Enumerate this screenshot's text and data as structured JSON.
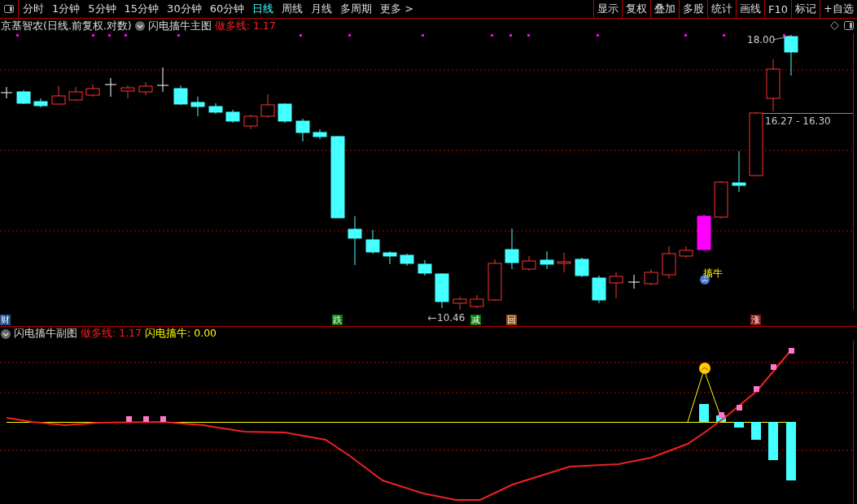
{
  "toolbar": {
    "periods": [
      {
        "label": "分时",
        "selected": false
      },
      {
        "label": "1分钟",
        "selected": false
      },
      {
        "label": "5分钟",
        "selected": false
      },
      {
        "label": "15分钟",
        "selected": false
      },
      {
        "label": "30分钟",
        "selected": false
      },
      {
        "label": "60分钟",
        "selected": false
      },
      {
        "label": "日线",
        "selected": true
      },
      {
        "label": "周线",
        "selected": false
      },
      {
        "label": "月线",
        "selected": false
      },
      {
        "label": "多周期",
        "selected": false
      },
      {
        "label": "更多 >",
        "selected": false
      }
    ],
    "buttons": [
      "显示",
      "复权",
      "叠加",
      "多股",
      "统计",
      "画线",
      "F10",
      "标记",
      "+自选"
    ]
  },
  "main_chart": {
    "title": "京基智农(日线.前复权.对数)",
    "indicator": "闪电搐牛主图",
    "value_label": "做多线: 1.17",
    "high_label": "18.00",
    "range_label": "16.27 - 16.30",
    "low_label": "10.46",
    "signal_label": "搐牛"
  },
  "signals": [
    {
      "label": "财",
      "color": "#1c4f8c"
    },
    {
      "label": "跌",
      "color": "#0a7a0a"
    },
    {
      "label": "减",
      "color": "#0a7a0a"
    },
    {
      "label": "回",
      "color": "#8a4a10"
    },
    {
      "label": "涨",
      "color": "#8a1010"
    }
  ],
  "sub_chart": {
    "title": "闪电搐牛副图",
    "legend": [
      {
        "label": "做多线: 1.17",
        "color": "#ff2020"
      },
      {
        "label": "闪电搐牛: 0.00",
        "color": "#ffff00"
      }
    ]
  }
}
